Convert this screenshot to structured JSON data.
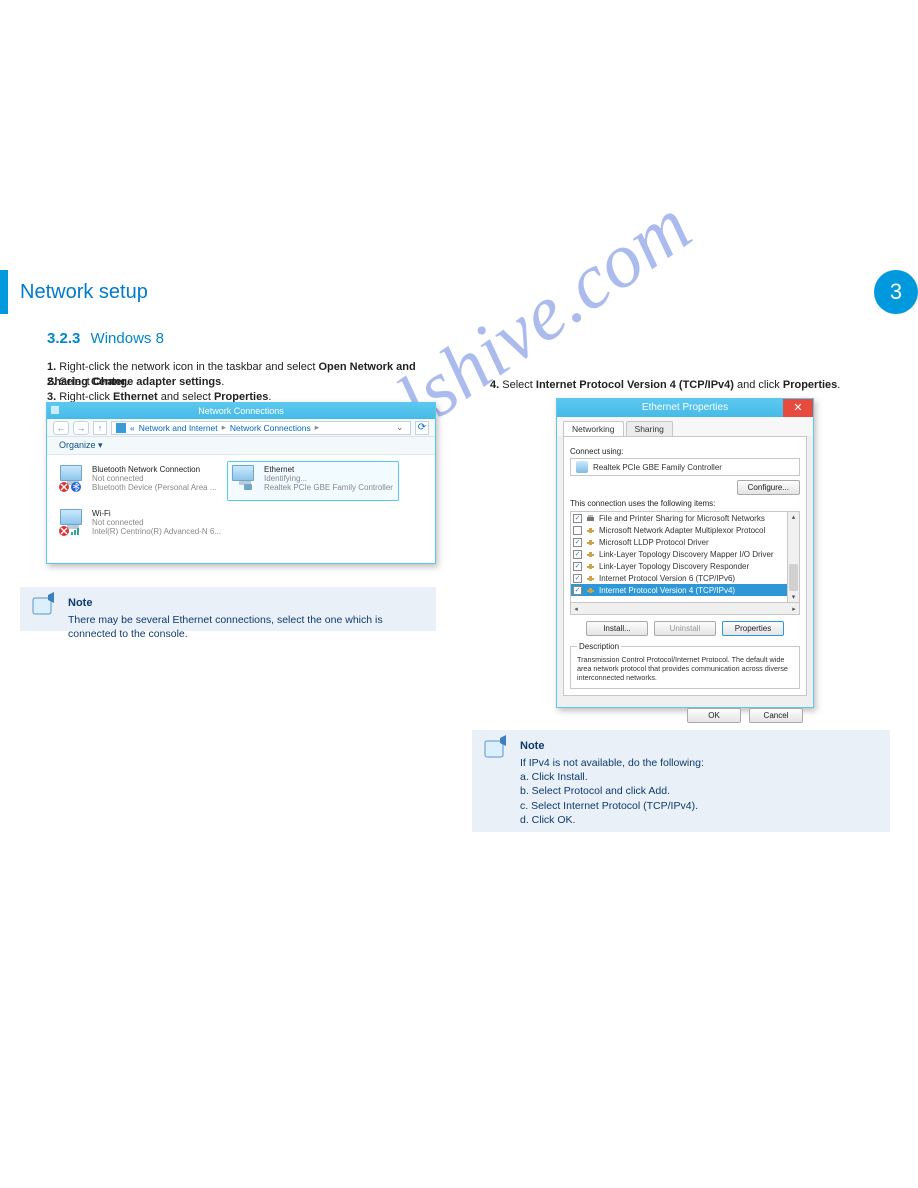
{
  "header": {
    "title": "Network setup",
    "badge": "3"
  },
  "section": {
    "number": "3.2.3",
    "title": "Windows 8"
  },
  "instr": {
    "step1_num": "1.",
    "step1_a": "Right-click the network icon in the taskbar and select ",
    "step1_b": "Open Network and Sharing Center",
    "step1_c": ".",
    "step2_num": "2.",
    "step2_a": "Select ",
    "step2_b": "Change adapter settings",
    "step2_c": ".",
    "step3_num": "3.",
    "step3_a": "Right-click ",
    "step3_b": "Ethernet",
    "step3_c": " and select ",
    "step3_d": "Properties",
    "step3_e": ".",
    "step4_num": "4.",
    "step4_a": "Select ",
    "step4_b": "Internet Protocol Version 4 (TCP/IPv4)",
    "step4_c": " and click ",
    "step4_d": "Properties",
    "step4_e": "."
  },
  "note1": {
    "title": "Note",
    "text": "There may be several Ethernet connections, select the one which is connected to the console."
  },
  "note2": {
    "title": "Note",
    "lines": [
      "If IPv4 is not available, do the following:",
      "a. Click Install.",
      "b. Select Protocol and click Add.",
      "c. Select Internet Protocol (TCP/IPv4).",
      "d. Click OK."
    ]
  },
  "nc": {
    "title": "Network Connections",
    "breadcrumb": [
      "Network and Internet",
      "Network Connections"
    ],
    "organize": "Organize ▾",
    "items": [
      {
        "name": "Bluetooth Network Connection",
        "status": "Not connected",
        "desc": "Bluetooth Device (Personal Area ...",
        "badge": "bt-x"
      },
      {
        "name": "Ethernet",
        "status": "Identifying...",
        "desc": "Realtek PCIe GBE Family Controller",
        "selected": true,
        "badge": "plug"
      },
      {
        "name": "Wi-Fi",
        "status": "Not connected",
        "desc": "Intel(R) Centrino(R) Advanced-N 6...",
        "badge": "wifi-x"
      }
    ]
  },
  "ep": {
    "title": "Ethernet Properties",
    "tabs": {
      "networking": "Networking",
      "sharing": "Sharing"
    },
    "connect_using": "Connect using:",
    "adapter": "Realtek PCIe GBE Family Controller",
    "configure": "Configure...",
    "uses_label": "This connection uses the following items:",
    "items": [
      {
        "checked": true,
        "icon": "printer",
        "label": "File and Printer Sharing for Microsoft Networks"
      },
      {
        "checked": false,
        "icon": "proto",
        "label": "Microsoft Network Adapter Multiplexor Protocol"
      },
      {
        "checked": true,
        "icon": "proto",
        "label": "Microsoft LLDP Protocol Driver"
      },
      {
        "checked": true,
        "icon": "proto",
        "label": "Link-Layer Topology Discovery Mapper I/O Driver"
      },
      {
        "checked": true,
        "icon": "proto",
        "label": "Link-Layer Topology Discovery Responder"
      },
      {
        "checked": true,
        "icon": "proto",
        "label": "Internet Protocol Version 6 (TCP/IPv6)"
      },
      {
        "checked": true,
        "icon": "proto",
        "label": "Internet Protocol Version 4 (TCP/IPv4)",
        "selected": true
      }
    ],
    "install": "Install...",
    "uninstall": "Uninstall",
    "properties": "Properties",
    "description_label": "Description",
    "description": "Transmission Control Protocol/Internet Protocol. The default wide area network protocol that provides communication across diverse interconnected networks.",
    "ok": "OK",
    "cancel": "Cancel"
  },
  "watermark": "manualshive.com"
}
